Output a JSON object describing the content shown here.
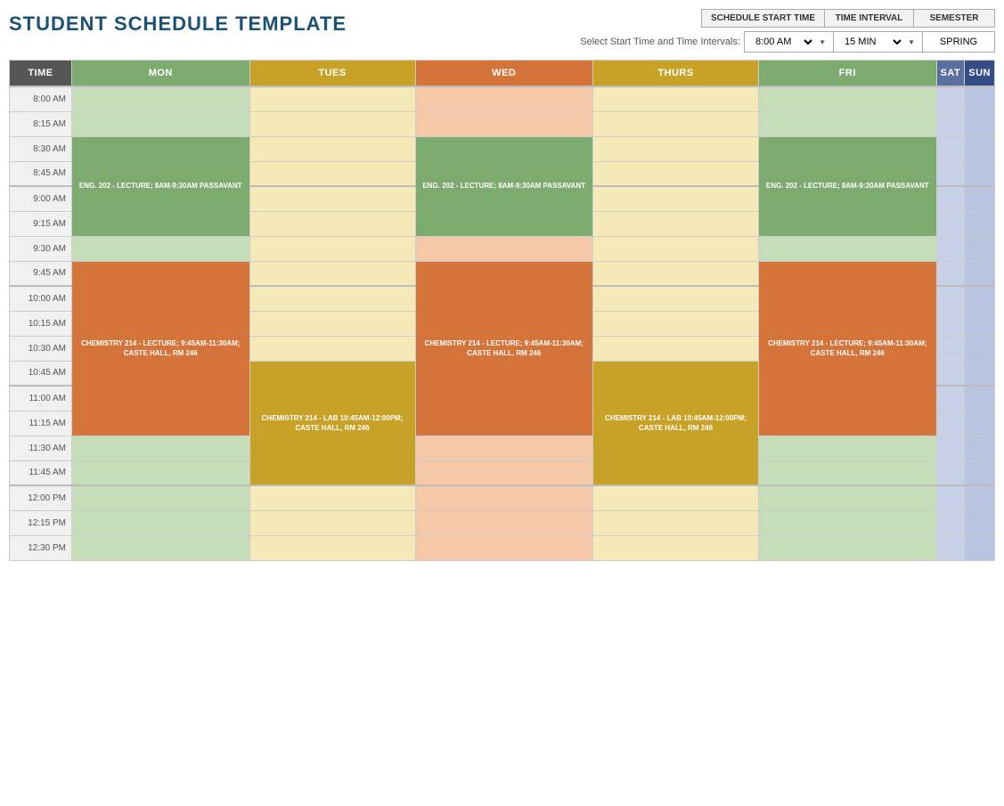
{
  "title": "STUDENT SCHEDULE TEMPLATE",
  "controls": {
    "label": "Select Start Time and Time Intervals:",
    "start_time_header": "SCHEDULE START TIME",
    "time_interval_header": "TIME INTERVAL",
    "semester_header": "SEMESTER",
    "start_time_value": "8:00 AM",
    "time_interval_value": "15 MIN",
    "semester_value": "SPRING"
  },
  "columns": {
    "time": "TIME",
    "mon": "MON",
    "tues": "TUES",
    "wed": "WED",
    "thurs": "THURS",
    "fri": "FRI",
    "sat": "SAT",
    "sun": "SUN"
  },
  "events": {
    "eng202_mon": "ENG. 202 - LECTURE;\n8AM-9:30AM\nPASSAVANT",
    "eng202_wed": "ENG. 202 - LECTURE;\n8AM-9:30AM\nPASSAVANT",
    "eng202_fri": "ENG. 202 - LECTURE;\n8AM-9:30AM\nPASSAVANT",
    "chem214_lec_mon": "CHEMISTRY 214 -\nLECTURE;\n9:45AM-11:30AM;\nCASTE HALL, RM 246",
    "chem214_lec_wed": "CHEMISTRY 214 -\nLECTURE;\n9:45AM-11:30AM;\nCASTE HALL, RM 246",
    "chem214_lec_fri": "CHEMISTRY 214 -\nLECTURE;\n9:45AM-11:30AM;\nCASTE HALL, RM 246",
    "chem214_lab_tues": "CHEMISTRY 214 - LAB\n10:45AM-12:00PM;\nCASTE HALL, RM 246",
    "chem214_lab_thurs": "CHEMISTRY 214 - LAB\n10:45AM-12:00PM;\nCASTE HALL, RM 246"
  },
  "time_slots": [
    "8:00 AM",
    "8:15 AM",
    "8:30 AM",
    "8:45 AM",
    "9:00 AM",
    "9:15 AM",
    "9:30 AM",
    "9:45 AM",
    "10:00 AM",
    "10:15 AM",
    "10:30 AM",
    "10:45 AM",
    "11:00 AM",
    "11:15 AM",
    "11:30 AM",
    "11:45 AM",
    "12:00 PM",
    "12:15 PM",
    "12:30 PM"
  ]
}
